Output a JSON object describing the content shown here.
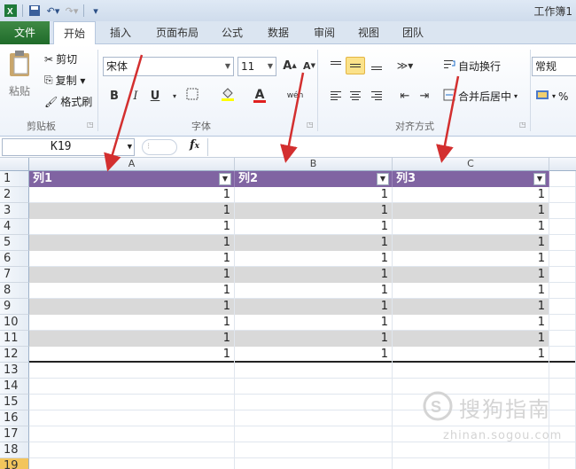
{
  "title_bar": {
    "title": "工作簿1"
  },
  "tabs": [
    "文件",
    "开始",
    "插入",
    "页面布局",
    "公式",
    "数据",
    "审阅",
    "视图",
    "团队"
  ],
  "ribbon": {
    "clipboard": {
      "paste": "粘贴",
      "cut": "剪切",
      "copy": "复制 ▾",
      "format_painter": "格式刷",
      "label": "剪贴板"
    },
    "font": {
      "name": "宋体",
      "size": "11",
      "bold": "B",
      "italic": "I",
      "underline": "U",
      "label": "字体",
      "font_color_letter": "A",
      "grow": "A",
      "shrink": "A",
      "phonetic": "wén"
    },
    "alignment": {
      "wrap_text": "自动换行",
      "merge_center": "合并后居中",
      "label": "对齐方式"
    },
    "number": {
      "format": "常规",
      "percent": "%"
    }
  },
  "formula_bar": {
    "name_box": "K19",
    "fx": "fx",
    "content": ""
  },
  "sheet": {
    "columns": [
      "A",
      "B",
      "C"
    ],
    "header_row": [
      "列1",
      "列2",
      "列3"
    ],
    "row_numbers": [
      "1",
      "2",
      "3",
      "4",
      "5",
      "6",
      "7",
      "8",
      "9",
      "10",
      "11",
      "12",
      "13",
      "14",
      "15",
      "16",
      "17",
      "18",
      "19"
    ],
    "data_rows": [
      [
        "1",
        "1",
        "1"
      ],
      [
        "1",
        "1",
        "1"
      ],
      [
        "1",
        "1",
        "1"
      ],
      [
        "1",
        "1",
        "1"
      ],
      [
        "1",
        "1",
        "1"
      ],
      [
        "1",
        "1",
        "1"
      ],
      [
        "1",
        "1",
        "1"
      ],
      [
        "1",
        "1",
        "1"
      ],
      [
        "1",
        "1",
        "1"
      ],
      [
        "1",
        "1",
        "1"
      ],
      [
        "1",
        "1",
        "1"
      ]
    ],
    "selected_row": "19",
    "table_header_color": "#8064a2",
    "band_color": "#d9d9d9"
  },
  "watermark": {
    "line1": "搜狗指南",
    "line2": "zhinan.sogou.com"
  },
  "colors": {
    "file_tab": "#2e7d32",
    "arrow": "#d32f2f"
  }
}
